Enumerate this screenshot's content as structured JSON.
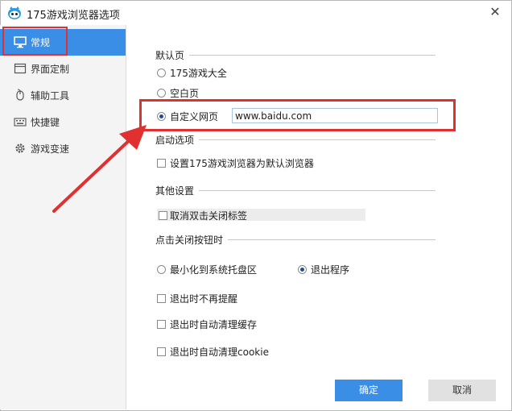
{
  "window": {
    "title": "175游戏浏览器选项"
  },
  "sidebar": {
    "items": [
      {
        "label": "常规",
        "icon": "monitor-icon",
        "active": true
      },
      {
        "label": "界面定制",
        "icon": "window-icon"
      },
      {
        "label": "辅助工具",
        "icon": "mouse-icon"
      },
      {
        "label": "快捷键",
        "icon": "keyboard-icon"
      },
      {
        "label": "游戏变速",
        "icon": "gear-icon"
      }
    ]
  },
  "default_page": {
    "title": "默认页",
    "options": [
      {
        "label": "175游戏大全",
        "checked": false
      },
      {
        "label": "空白页",
        "checked": false
      },
      {
        "label": "自定义网页",
        "checked": true
      }
    ],
    "custom_url": "www.baidu.com"
  },
  "startup": {
    "title": "启动选项",
    "set_default_label": "设置175游戏浏览器为默认浏览器"
  },
  "other": {
    "title": "其他设置",
    "cancel_dblclick_label": "取消双击关闭标签"
  },
  "close_button": {
    "title": "点击关闭按钮时",
    "minimize_label": "最小化到系统托盘区",
    "exit_label": "退出程序",
    "no_remind_label": "退出时不再提醒",
    "clear_cache_label": "退出时自动清理缓存",
    "clear_cookie_label": "退出时自动清理cookie"
  },
  "buttons": {
    "ok": "确定",
    "cancel": "取消"
  },
  "colors": {
    "accent": "#3a8ee6",
    "annotation": "#e03030"
  }
}
